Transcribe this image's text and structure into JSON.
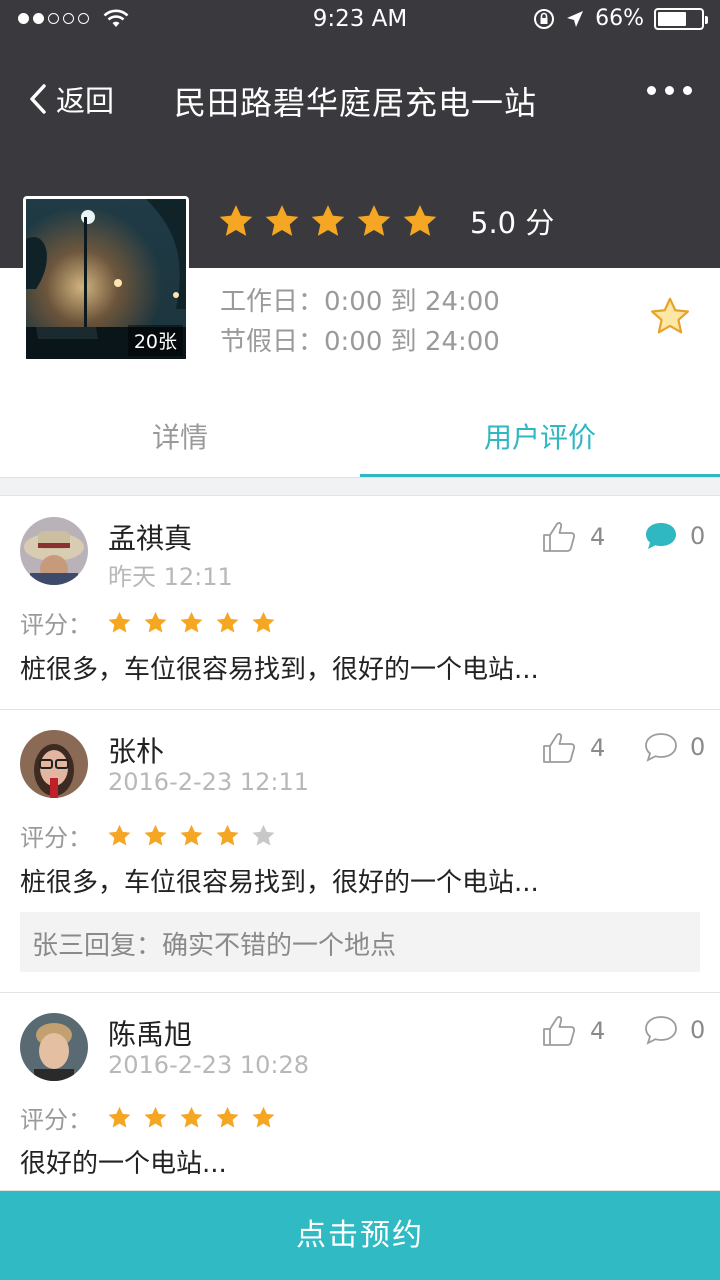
{
  "status_bar": {
    "time": "9:23 AM",
    "battery": "66%",
    "battery_level": 0.66
  },
  "nav": {
    "back_label": "返回",
    "title": "民田路碧华庭居充电一站"
  },
  "station": {
    "photo_count": "20张",
    "rating": 5,
    "score_text": "5.0 分",
    "hours": [
      "工作日：0:00 到 24:00",
      "节假日：0:00 到 24:00"
    ]
  },
  "tabs": {
    "detail": "详情",
    "reviews": "用户评价",
    "active": "reviews"
  },
  "reviews": [
    {
      "name": "孟祺真",
      "time": "昨天 12:11",
      "score_label": "评分：",
      "stars": 5,
      "likes": "4",
      "comments": "0",
      "text": "桩很多，车位很容易找到，很好的一个电站...",
      "reply": "",
      "comment_active": true
    },
    {
      "name": "张朴",
      "time": "2016-2-23 12:11",
      "score_label": "评分：",
      "stars": 4,
      "likes": "4",
      "comments": "0",
      "text": "桩很多，车位很容易找到，很好的一个电站...",
      "reply": "张三回复：确实不错的一个地点",
      "comment_active": false
    },
    {
      "name": "陈禹旭",
      "time": "2016-2-23 10:28",
      "score_label": "评分：",
      "stars": 5,
      "likes": "4",
      "comments": "0",
      "text": "很好的一个电站...",
      "reply": "",
      "comment_active": false
    }
  ],
  "book_button": "点击预约",
  "colors": {
    "accent": "#2fb7c2",
    "header": "#3a3a3e",
    "star": "#f5a623",
    "star_empty": "#c8c8c8"
  }
}
